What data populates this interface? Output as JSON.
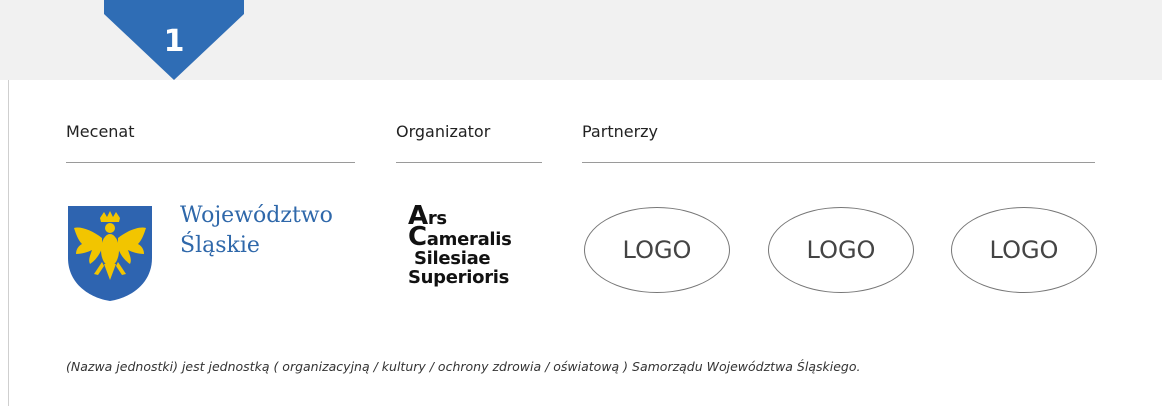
{
  "badge": {
    "number": "1"
  },
  "sections": {
    "mecenat": "Mecenat",
    "organizator": "Organizator",
    "partnerzy": "Partnerzy"
  },
  "wojewodztwo": {
    "line1": "Województwo",
    "line2": "Śląskie"
  },
  "ars": {
    "l1a": "A",
    "l1b": "rs",
    "l2a": "C",
    "l2b": "ameralis",
    "l3a": "S",
    "l3b": "ilesiae",
    "l4a": "S",
    "l4b": "uperioris"
  },
  "partners": [
    "LOGO",
    "LOGO",
    "LOGO"
  ],
  "footnote": "(Nazwa jednostki) jest jednostką ( organizacyjną / kultury / ochrony zdrowia / oświatową ) Samorządu Województwa Śląskiego.",
  "colors": {
    "badge": "#2f6db5",
    "coat_blue": "#2e64b0",
    "eagle_gold": "#f2c500",
    "woj_text": "#2f68aa",
    "top_band": "#f1f1f1"
  }
}
